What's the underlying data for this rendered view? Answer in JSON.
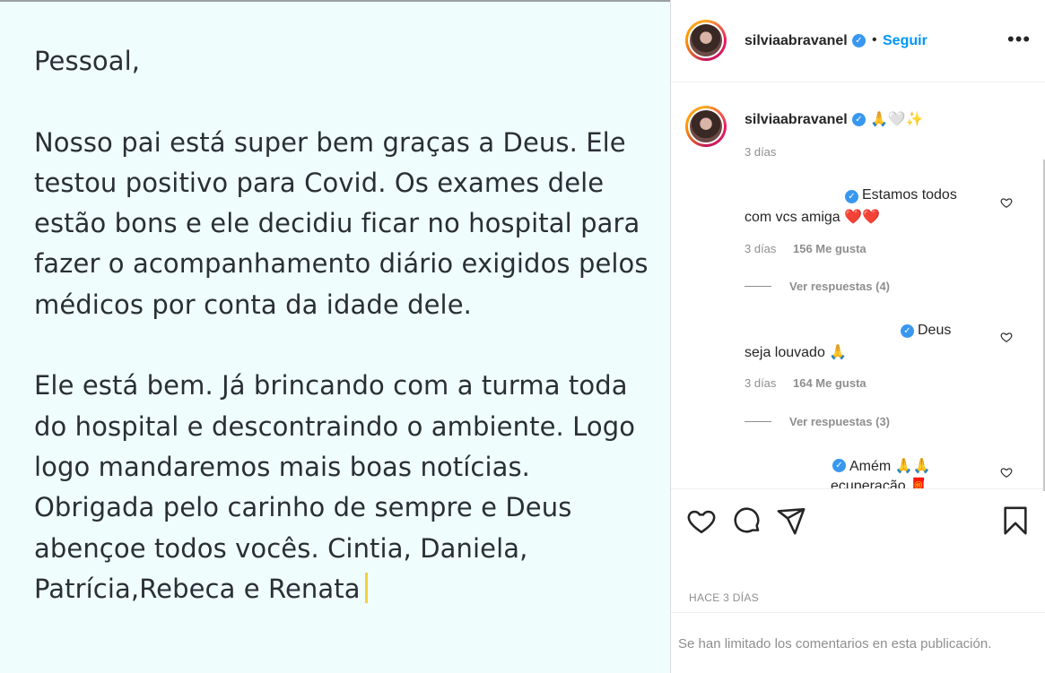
{
  "post": {
    "greeting": "Pessoal,",
    "paragraph1": "Nosso pai está super bem graças a Deus. Ele testou positivo para Covid. Os exames dele estão bons e ele decidiu ficar no hospital para fazer o acompanhamento diário exigidos pelos médicos por conta da idade dele.",
    "paragraph2": "Ele está bem. Já brincando com a turma toda do hospital e descontraindo o ambiente. Logo logo mandaremos mais boas notícias. Obrigada pelo carinho de sempre e Deus abençoe todos vocês. Cintia, Daniela, Patrícia,Rebeca e Renata"
  },
  "header": {
    "username": "silviaabravanel",
    "separator": "•",
    "follow_label": "Seguir",
    "more_label": "•••"
  },
  "caption": {
    "username": "silviaabravanel",
    "text": "🙏🤍✨",
    "time": "3 días"
  },
  "comments": [
    {
      "text_line1": "Estamos todos",
      "text_line2": "com vcs amiga ❤️❤️",
      "time": "3 días",
      "likes": "156 Me gusta",
      "replies": "Ver respuestas (4)"
    },
    {
      "text_line1": "Deus",
      "text_line2": "seja louvado 🙏",
      "time": "3 días",
      "likes": "164 Me gusta",
      "replies": "Ver respuestas (3)"
    },
    {
      "text_line1": "Amém 🙏🙏",
      "text_line2": "ecuperação 🧧"
    }
  ],
  "footer": {
    "time_ago": "HACE 3 DÍAS",
    "limited_notice": "Se han limitado los comentarios en esta publicación."
  },
  "colors": {
    "accent": "#0095f6",
    "verified": "#3897f0",
    "post_bg": "#f0fdfd"
  }
}
